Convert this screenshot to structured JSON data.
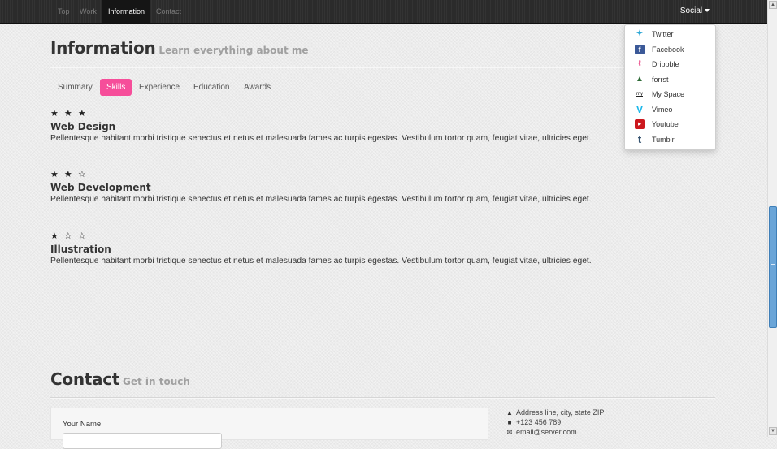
{
  "navbar": {
    "items": [
      {
        "label": "Top",
        "active": false
      },
      {
        "label": "Work",
        "active": false
      },
      {
        "label": "Information",
        "active": true
      },
      {
        "label": "Contact",
        "active": false
      }
    ],
    "social_label": "Social"
  },
  "information": {
    "title": "Information",
    "subtitle": "Learn everything about me",
    "tabs": [
      {
        "label": "Summary",
        "active": false
      },
      {
        "label": "Skills",
        "active": true
      },
      {
        "label": "Experience",
        "active": false
      },
      {
        "label": "Education",
        "active": false
      },
      {
        "label": "Awards",
        "active": false
      }
    ],
    "skills": [
      {
        "stars": "★ ★ ★",
        "name": "Web Design",
        "description": "Pellentesque habitant morbi tristique senectus et netus et malesuada fames ac turpis egestas. Vestibulum tortor quam, feugiat vitae, ultricies eget."
      },
      {
        "stars": "★ ★ ☆",
        "name": "Web Development",
        "description": "Pellentesque habitant morbi tristique senectus et netus et malesuada fames ac turpis egestas. Vestibulum tortor quam, feugiat vitae, ultricies eget."
      },
      {
        "stars": "★ ☆ ☆",
        "name": "Illustration",
        "description": "Pellentesque habitant morbi tristique senectus et netus et malesuada fames ac turpis egestas. Vestibulum tortor quam, feugiat vitae, ultricies eget."
      }
    ]
  },
  "contact": {
    "title": "Contact",
    "subtitle": "Get in touch",
    "form": {
      "name_label": "Your Name",
      "name_value": ""
    },
    "info": {
      "address": "Address line, city, state ZIP",
      "phone": "+123 456 789",
      "email": "email@server.com"
    }
  },
  "social_menu": {
    "items": [
      {
        "label": "Twitter",
        "icon": "twitter-icon",
        "color": "#2fa8d6"
      },
      {
        "label": "Facebook",
        "icon": "facebook-icon",
        "color": "#3b5998"
      },
      {
        "label": "Dribbble",
        "icon": "dribbble-icon",
        "color": "#ea4c89"
      },
      {
        "label": "forrst",
        "icon": "forrst-icon",
        "color": "#2d6a36"
      },
      {
        "label": "My Space",
        "icon": "myspace-icon",
        "color": "#222222"
      },
      {
        "label": "Vimeo",
        "icon": "vimeo-icon",
        "color": "#1ab7ea"
      },
      {
        "label": "Youtube",
        "icon": "youtube-icon",
        "color": "#cc181e"
      },
      {
        "label": "Tumblr",
        "icon": "tumblr-icon",
        "color": "#34526f"
      }
    ]
  },
  "colors": {
    "accent": "#f64e9a",
    "navbar": "#2b2b2b",
    "scroll_thumb": "#6aa5d8"
  }
}
